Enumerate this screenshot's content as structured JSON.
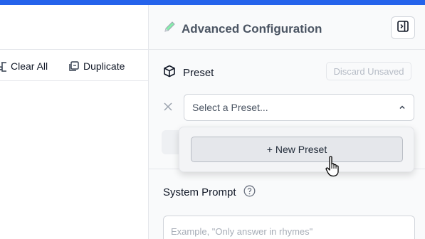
{
  "toolbar": {
    "clear_all_label": "Clear All",
    "duplicate_label": "Duplicate"
  },
  "config_panel": {
    "title": "Advanced Configuration",
    "title_icon": "pencil-icon",
    "toggle_icon": "panel-right-icon"
  },
  "preset": {
    "label": "Preset",
    "icon": "cube-icon",
    "discard_label": "Discard Unsaved",
    "clear_icon": "close-icon",
    "select_placeholder": "Select a Preset...",
    "chevron_icon": "chevron-up-icon",
    "dropdown": {
      "new_preset_label": "+ New Preset"
    }
  },
  "system_prompt": {
    "label": "System Prompt",
    "help_icon": "question-circle-icon",
    "placeholder": "Example, \"Only answer in rhymes\""
  },
  "colors": {
    "accent": "#2563eb",
    "panel_bg": "#f9fafb",
    "border": "#d1d5db"
  }
}
